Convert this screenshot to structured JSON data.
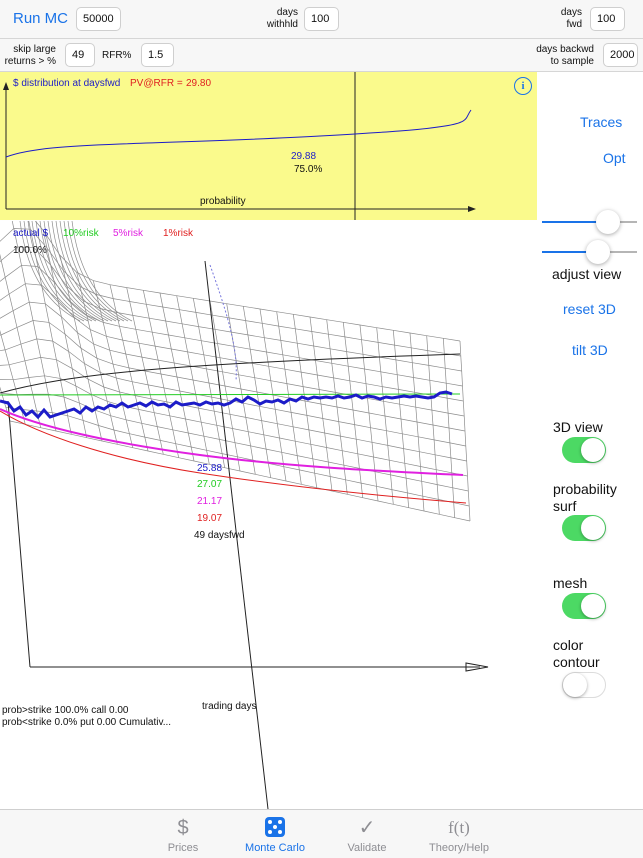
{
  "top_bar": {
    "run_label": "Run MC",
    "run_count": "50000",
    "days_withhld_label_1": "days",
    "days_withhld_label_2": "withhld",
    "days_withhld_value": "100",
    "days_fwd_label_1": "days",
    "days_fwd_label_2": "fwd",
    "days_fwd_value": "100"
  },
  "second_bar": {
    "skip_label_1": "skip large",
    "skip_label_2": "returns > %",
    "skip_value": "49",
    "rfr_label": "RFR%",
    "rfr_value": "1.5",
    "backwd_label_1": "days backwd",
    "backwd_label_2": "to sample",
    "backwd_value": "2000"
  },
  "distribution_panel": {
    "title": "$ distribution at daysfwd",
    "pv_label": "PV@RFR =",
    "pv_value": "29.80",
    "marker_value": "29.88",
    "marker_percent": "75.0%",
    "x_label": "probability",
    "info_symbol": "i"
  },
  "legend": {
    "actual": "actual $",
    "risk10": "10%risk",
    "risk5": "5%risk",
    "risk1": "1%risk",
    "percent": "100.0%"
  },
  "readouts": {
    "v1": "25.88",
    "v2": "27.07",
    "v3": "21.17",
    "v4": "19.07",
    "days": "49 daysfwd"
  },
  "axis": {
    "trading_days": "trading days"
  },
  "bottom_text": {
    "line1": "prob>strike 100.0%  call  0.00",
    "line2": "prob<strike  0.0%  put  0.00  Cumulativ..."
  },
  "sidebar": {
    "traces": "Traces",
    "opt": "Opt",
    "adjust_view": "adjust view",
    "reset_3d": "reset 3D",
    "tilt_3d": "tilt 3D",
    "view3d": "3D view",
    "prob_surf_1": "probability",
    "prob_surf_2": "surf",
    "mesh": "mesh",
    "color_contour_1": "color",
    "color_contour_2": "contour"
  },
  "tabs": [
    {
      "label": "Prices",
      "glyph": "$"
    },
    {
      "label": "Monte Carlo",
      "glyph": "⚅"
    },
    {
      "label": "Validate",
      "glyph": "✓"
    },
    {
      "label": "Theory/Help",
      "glyph": "f(t)"
    }
  ],
  "colors": {
    "accent": "#1a73e8",
    "panel_yellow": "#fafa8c",
    "switch_on": "#4cd964",
    "actual_line": "#1c1cc8",
    "risk10": "#22cc22",
    "risk5": "#e020e0",
    "risk1": "#e02020"
  }
}
